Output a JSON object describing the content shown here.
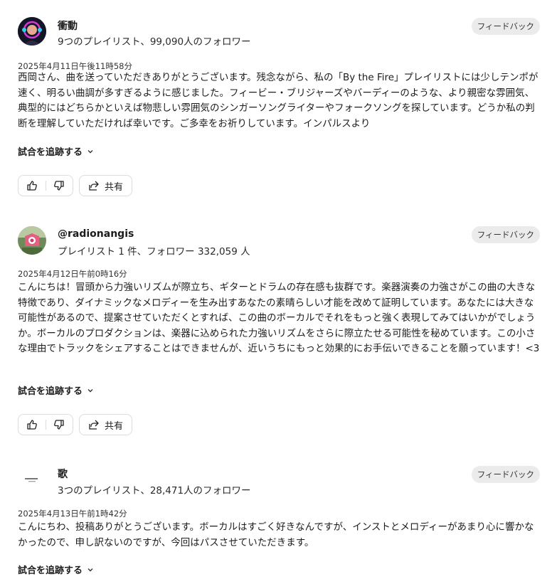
{
  "feedback_label": "フィードバック",
  "track_label": "試合を追跡する",
  "share_label": "共有",
  "comments": [
    {
      "name": "衝動",
      "followers": "9つのプレイリスト、99,090人のフォロワー",
      "date": "2025年4月11日午後11時58分",
      "message": "西岡さん、曲を送っていただきありがとうございます。残念ながら、私の「By the Fire」プレイリストには少しテンポが速く、明るい曲調が多すぎるように感じました。フィービー・ブリジャーズやバーディーのような、より親密な雰囲気、典型的にはどちらかといえば物悲しい雰囲気のシンガーソングライターやフォークソングを探しています。どうか私の判断を理解していただければ幸いです。ご多幸をお祈りしています。インパルスより"
    },
    {
      "name": "@radionangis",
      "followers": "プレイリスト 1 件、フォロワー 332,059 人",
      "date": "2025年4月12日午前0時16分",
      "message": "こんにちは！冒頭から力強いリズムが際立ち、ギターとドラムの存在感も抜群です。楽器演奏の力強さがこの曲の大きな特徴であり、ダイナミックなメロディーを生み出すあなたの素晴らしい才能を改めて証明しています。あなたには大きな可能性があるので、提案させていただくとすれば、この曲のボーカルでそれをもっと強く表現してみてはいかがでしょうか。ボーカルのプロダクションは、楽器に込められた力強いリズムをさらに際立たせる可能性を秘めています。この小さな理由でトラックをシェアすることはできませんが、近いうちにもっと効果的にお手伝いできることを願っています！<3"
    },
    {
      "name": "歌",
      "followers": "3つのプレイリスト、28,471人のフォロワー",
      "date": "2025年4月13日午前1時42分",
      "message": "こんにちわ、投稿ありがとうございます。ボーカルはすごく好きなんですが、インストとメロディーがあまり心に響かなかったので、申し訳ないのですが、今回はパスさせていただきます。"
    }
  ]
}
